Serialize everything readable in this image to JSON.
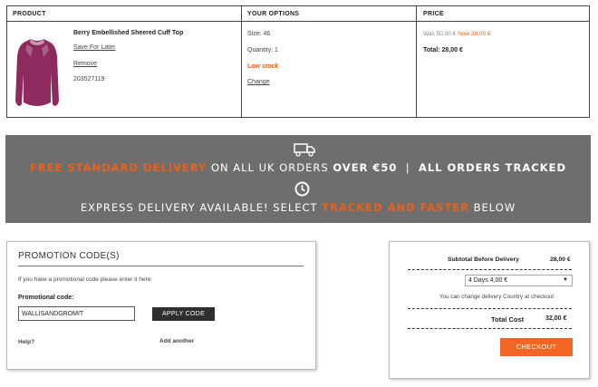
{
  "cart": {
    "headers": {
      "product": "PRODUCT",
      "options": "YOUR OPTIONS",
      "price": "PRICE"
    },
    "item": {
      "name": "Berry Embellished Sheered Cuff Top",
      "save_for_later": "Save For Later",
      "remove": "Remove",
      "code": "203527119",
      "size": "Size: 46",
      "quantity": "Quantity: 1",
      "stock": "Low stock",
      "change": "Change",
      "was_price": "Was 50,00 €",
      "now_price": "Now 28,00 €",
      "total": "Total:  28,00 €"
    },
    "colors": {
      "product": "#8e2a5e",
      "accent": "#e8621a"
    }
  },
  "banner": {
    "line1_a": "FREE STANDARD DELIVERY",
    "line1_b": " ON ALL UK ORDERS ",
    "line1_c": "OVER €50",
    "line1_d": "  |  ",
    "line1_e": "ALL ORDERS TRACKED",
    "line2_a": "EXPRESS DELIVERY AVAILABLE! SELECT ",
    "line2_b": "TRACKED AND FASTER",
    "line2_c": " BELOW",
    "icons": [
      "truck-icon",
      "clock-icon"
    ]
  },
  "promo": {
    "title": "PROMOTION CODE(S)",
    "description": "If you have a promotional code please enter it here:",
    "label": "Promotional code:",
    "value": "WALLISANDGROMIT",
    "apply": "APPLY CODE",
    "help": "Help?",
    "add_another": "Add another"
  },
  "summary": {
    "subtotal_label": "Subtotal Before Delivery",
    "subtotal_value": "28,00 €",
    "delivery_option": "4 Days 4,00 €",
    "change_note": "You can change delivery Country at checkout",
    "total_label": "Total Cost",
    "total_value": "32,00 €",
    "checkout": "CHECKOUT"
  }
}
